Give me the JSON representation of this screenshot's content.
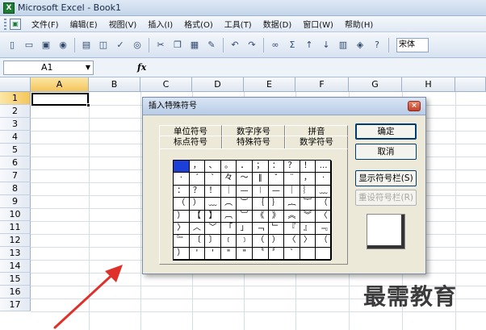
{
  "window": {
    "title": "Microsoft Excel - Book1",
    "app_icon": "excel-icon"
  },
  "menu": [
    "文件(F)",
    "编辑(E)",
    "视图(V)",
    "插入(I)",
    "格式(O)",
    "工具(T)",
    "数据(D)",
    "窗口(W)",
    "帮助(H)"
  ],
  "toolbar": {
    "font_name": "宋体"
  },
  "formula_bar": {
    "name_box": "A1",
    "fx_label": "fx"
  },
  "columns": [
    "A",
    "B",
    "C",
    "D",
    "E",
    "F",
    "G",
    "H"
  ],
  "rows": [
    "1",
    "2",
    "3",
    "4",
    "5",
    "6",
    "7",
    "8",
    "9",
    "10",
    "11",
    "12",
    "13",
    "14",
    "15",
    "16",
    "17"
  ],
  "dialog": {
    "title": "插入特殊符号",
    "tabs_back": [
      "单位符号",
      "数字序号",
      "拼音"
    ],
    "tabs_front": [
      "标点符号",
      "特殊符号",
      "数学符号"
    ],
    "selected_tab": "标点符号",
    "symbols": [
      [
        "",
        "，",
        "、",
        "。",
        "．",
        "；",
        "：",
        "？",
        "！",
        "…"
      ],
      [
        "·",
        "ˊ",
        "ˋ",
        "々",
        "～",
        "‖",
        "ˇ",
        "¨",
        "，",
        "·"
      ],
      [
        "：",
        "？",
        "！",
        "｜",
        "—",
        "︱",
        "—",
        "｜",
        "︴",
        "﹏"
      ],
      [
        "（",
        "）",
        "﹏",
        "︵",
        "︶",
        "｛",
        "｝",
        "︷",
        "︸",
        "（"
      ],
      [
        "）",
        "【",
        "】",
        "︹",
        "︺",
        "《",
        "》",
        "︽",
        "︾",
        "〈"
      ],
      [
        "〉",
        "︿",
        "﹀",
        "「",
        "」",
        "﹁",
        "﹂",
        "『",
        "』",
        "﹃"
      ],
      [
        "﹄",
        "〔",
        "〕",
        "﹝",
        "﹞",
        "（",
        "）",
        "〈",
        "〉",
        "（"
      ],
      [
        "）",
        "'",
        "'",
        "\"",
        "\"",
        "〝",
        "〞",
        "ˋ",
        "",
        ""
      ]
    ],
    "buttons": {
      "ok": "确定",
      "cancel": "取消",
      "show_bar": "显示符号栏(S)",
      "reset_bar": "重设符号栏(R)"
    }
  },
  "watermark": "最需教育"
}
